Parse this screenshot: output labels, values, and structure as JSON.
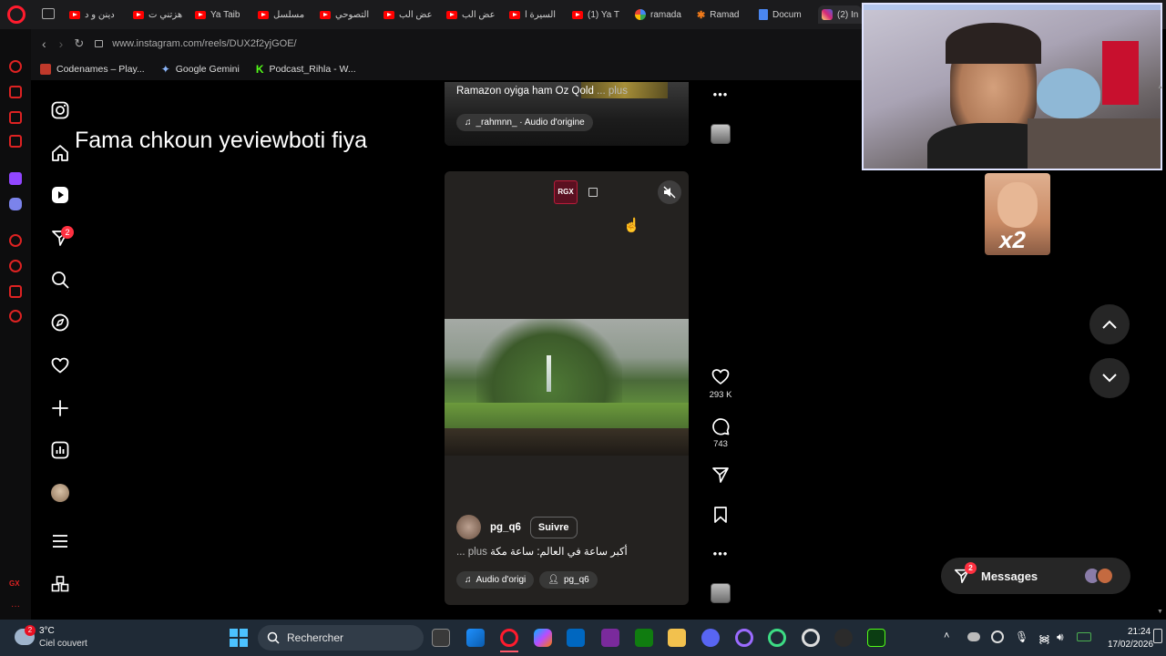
{
  "browser": {
    "tabs": [
      {
        "label": "دينن و د",
        "icon": "youtube-icon"
      },
      {
        "label": "هزتني ت",
        "icon": "youtube-icon"
      },
      {
        "label": "Ya Taib",
        "icon": "youtube-icon"
      },
      {
        "label": "مسلسل",
        "icon": "youtube-icon"
      },
      {
        "label": "التصوحي",
        "icon": "youtube-icon"
      },
      {
        "label": "عض الب",
        "icon": "youtube-icon"
      },
      {
        "label": "عض الب",
        "icon": "youtube-icon"
      },
      {
        "label": "السيرة ا",
        "icon": "youtube-icon"
      },
      {
        "label": "(1) Ya T",
        "icon": "youtube-icon"
      },
      {
        "label": "ramada",
        "icon": "google-icon"
      },
      {
        "label": "Ramad",
        "icon": "gamma-icon"
      },
      {
        "label": "Docum",
        "icon": "docs-icon"
      },
      {
        "label": "(2) In",
        "icon": "instagram-icon"
      }
    ],
    "url": "www.instagram.com/reels/DUX2f2yjGOE/",
    "bookmarks": [
      {
        "label": "Codenames – Play..."
      },
      {
        "label": "Google Gemini"
      },
      {
        "label": "Podcast_Rihla - W..."
      }
    ]
  },
  "overlay_text": "Fama chkoun yeviewboti fiya",
  "instagram": {
    "nav": [
      {
        "name": "instagram-logo-icon"
      },
      {
        "name": "home-icon"
      },
      {
        "name": "reels-icon"
      },
      {
        "name": "messages-icon",
        "badge": "2"
      },
      {
        "name": "search-icon"
      },
      {
        "name": "explore-icon"
      },
      {
        "name": "notifications-icon"
      },
      {
        "name": "create-icon"
      },
      {
        "name": "dashboard-icon"
      },
      {
        "name": "profile-avatar"
      },
      {
        "name": "menu-icon"
      },
      {
        "name": "meta-apps-icon"
      }
    ],
    "prev_reel": {
      "caption": "Ramazon oyiga ham Oz Qold",
      "more": "... plus",
      "audio": "_rahmnn_ · Audio d'origine"
    },
    "reel": {
      "badge": "RGX",
      "username": "pg_q6",
      "follow_label": "Suivre",
      "caption": "أكبر ساعة في العالم: ساعة مكة",
      "more": "... plus",
      "audio": "Audio d'origi",
      "tagged_user": "pg_q6"
    },
    "actions": {
      "likes": "293 K",
      "comments": "743"
    },
    "messages_label": "Messages",
    "messages_badge": "2"
  },
  "stream": {
    "emote_text": "x2"
  },
  "taskbar": {
    "weather_temp": "3°C",
    "weather_desc": "Ciel couvert",
    "weather_badge": "2",
    "search_placeholder": "Rechercher",
    "time": "21:24",
    "date": "17/02/2026"
  }
}
